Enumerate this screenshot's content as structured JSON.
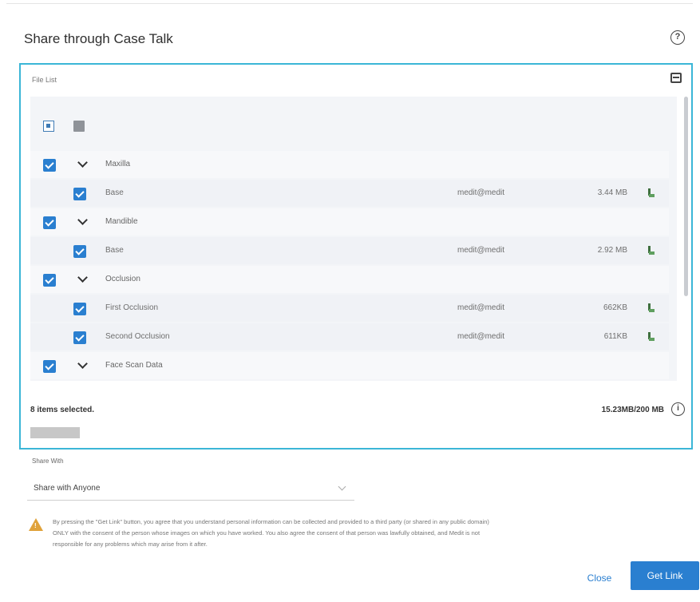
{
  "dialog": {
    "title": "Share through Case Talk",
    "help_icon": "?"
  },
  "file_list": {
    "label": "File List",
    "header_checkbox_state": "indeterminate",
    "groups": [
      {
        "name": "Maxilla",
        "checked": true,
        "files": [
          {
            "name": "Base",
            "owner": "medit@medit",
            "size": "3.44 MB",
            "checked": true
          }
        ]
      },
      {
        "name": "Mandible",
        "checked": true,
        "files": [
          {
            "name": "Base",
            "owner": "medit@medit",
            "size": "2.92 MB",
            "checked": true
          }
        ]
      },
      {
        "name": "Occlusion",
        "checked": true,
        "files": [
          {
            "name": "First Occlusion",
            "owner": "medit@medit",
            "size": "662KB",
            "checked": true
          },
          {
            "name": "Second Occlusion",
            "owner": "medit@medit",
            "size": "611KB",
            "checked": true
          }
        ]
      },
      {
        "name": "Face Scan Data",
        "checked": true,
        "files": []
      }
    ],
    "selected_count": "8 items selected.",
    "storage_usage": "15.23MB/200 MB",
    "info_icon": "i"
  },
  "share": {
    "label": "Share With",
    "selected_value": "Share with Anyone"
  },
  "disclaimer": {
    "line1": "By pressing the \"Get Link\" button, you agree that you understand personal information can be collected and provided to a third party (or shared in any public domain)",
    "line2": "ONLY with the consent of the person whose images on which you have worked. You also agree the consent of that person was lawfully obtained, and Medit is not",
    "line3": "responsible for any problems which may arise from it after."
  },
  "buttons": {
    "close": "Close",
    "get_link": "Get Link"
  },
  "colors": {
    "accent": "#2a7fd0",
    "panel_border": "#3bb6d7",
    "warning": "#e0a23a"
  }
}
